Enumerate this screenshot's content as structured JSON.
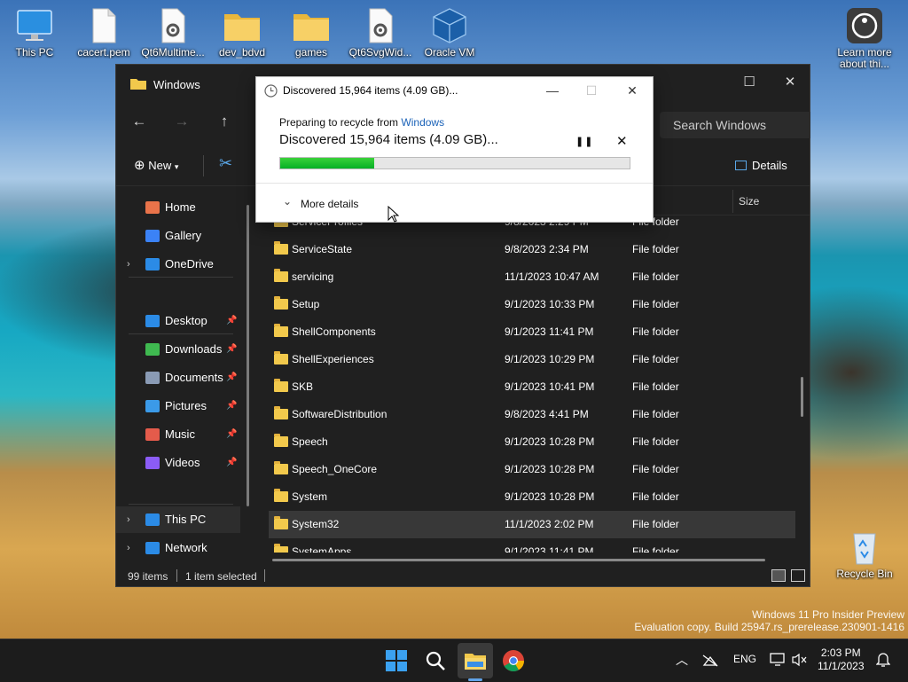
{
  "desktop": {
    "icons": [
      {
        "label": "This PC",
        "icon": "monitor-icon"
      },
      {
        "label": "cacert.pem",
        "icon": "document-icon"
      },
      {
        "label": "Qt6Multime...",
        "icon": "settings-file-icon"
      },
      {
        "label": "dev_bdvd",
        "icon": "folder-icon"
      },
      {
        "label": "games",
        "icon": "folder-icon"
      },
      {
        "label": "Qt6SvgWid...",
        "icon": "settings-file-icon"
      },
      {
        "label": "Oracle VM",
        "icon": "virtualbox-icon"
      },
      {
        "label": "Learn more about thi...",
        "icon": "learn-more-icon"
      },
      {
        "label": "Recycle Bin",
        "icon": "recycle-bin-icon"
      }
    ],
    "watermark_line1": "Windows 11 Pro Insider Preview",
    "watermark_line2": "Evaluation copy. Build 25947.rs_prerelease.230901-1416"
  },
  "explorer": {
    "title": "Windows",
    "search_placeholder": "Search Windows",
    "new_label": "New",
    "details_label": "Details",
    "sidebar": [
      {
        "label": "Home",
        "icon": "home-icon",
        "color": "#e8734a"
      },
      {
        "label": "Gallery",
        "icon": "gallery-icon",
        "color": "#3b82f6"
      },
      {
        "label": "OneDrive",
        "icon": "onedrive-icon",
        "color": "#2b8be6"
      },
      {
        "label": "Desktop",
        "icon": "desktop-icon",
        "color": "#2b8be6"
      },
      {
        "label": "Downloads",
        "icon": "download-icon",
        "color": "#3fb950"
      },
      {
        "label": "Documents",
        "icon": "documents-icon",
        "color": "#8a9bb5"
      },
      {
        "label": "Pictures",
        "icon": "pictures-icon",
        "color": "#3b9ae8"
      },
      {
        "label": "Music",
        "icon": "music-icon",
        "color": "#e45b4b"
      },
      {
        "label": "Videos",
        "icon": "videos-icon",
        "color": "#8b5cf6"
      },
      {
        "label": "This PC",
        "icon": "this-pc-icon",
        "color": "#2b8be6"
      },
      {
        "label": "Network",
        "icon": "network-icon",
        "color": "#2b8be6"
      }
    ],
    "columns": {
      "size": "Size"
    },
    "files": [
      {
        "name": "ServiceProfiles",
        "date": "9/8/2023 2:29 PM",
        "type": "File folder"
      },
      {
        "name": "ServiceState",
        "date": "9/8/2023 2:34 PM",
        "type": "File folder"
      },
      {
        "name": "servicing",
        "date": "11/1/2023 10:47 AM",
        "type": "File folder"
      },
      {
        "name": "Setup",
        "date": "9/1/2023 10:33 PM",
        "type": "File folder"
      },
      {
        "name": "ShellComponents",
        "date": "9/1/2023 11:41 PM",
        "type": "File folder"
      },
      {
        "name": "ShellExperiences",
        "date": "9/1/2023 10:29 PM",
        "type": "File folder"
      },
      {
        "name": "SKB",
        "date": "9/1/2023 10:41 PM",
        "type": "File folder"
      },
      {
        "name": "SoftwareDistribution",
        "date": "9/8/2023 4:41 PM",
        "type": "File folder"
      },
      {
        "name": "Speech",
        "date": "9/1/2023 10:28 PM",
        "type": "File folder"
      },
      {
        "name": "Speech_OneCore",
        "date": "9/1/2023 10:28 PM",
        "type": "File folder"
      },
      {
        "name": "System",
        "date": "9/1/2023 10:28 PM",
        "type": "File folder"
      },
      {
        "name": "System32",
        "date": "11/1/2023 2:02 PM",
        "type": "File folder",
        "selected": true
      },
      {
        "name": "SystemApps",
        "date": "9/1/2023 11:41 PM",
        "type": "File folder"
      }
    ],
    "status_items": "99 items",
    "status_selected": "1 item selected"
  },
  "dialog": {
    "title": "Discovered 15,964 items (4.09 GB)...",
    "prep_prefix": "Preparing to recycle from",
    "prep_link": "Windows",
    "big_text": "Discovered 15,964 items (4.09 GB)...",
    "progress_fraction": 0.27,
    "more_details": "More details"
  },
  "taskbar": {
    "lang": "ENG",
    "time": "2:03 PM",
    "date": "11/1/2023"
  }
}
